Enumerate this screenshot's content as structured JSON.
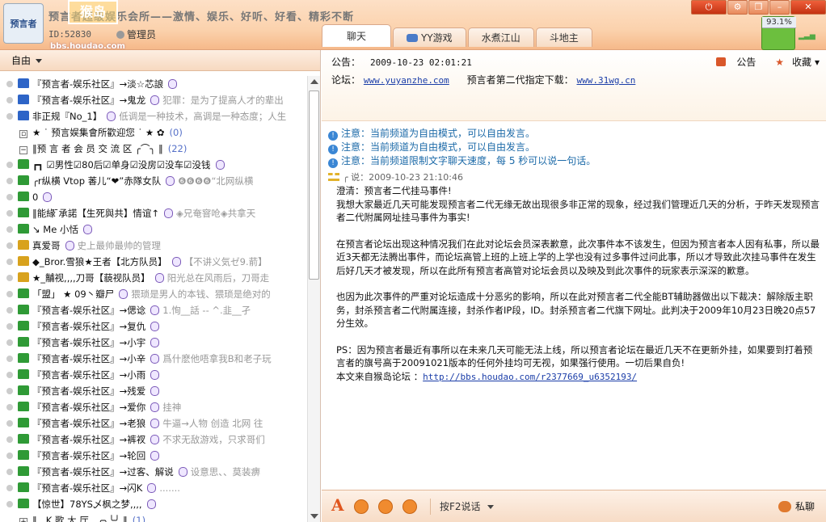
{
  "header": {
    "logo_text": "预言者",
    "room_title": "预言者超级娱乐会所——激情、娱乐、好听、好看、精彩不断",
    "room_id": "ID:52830",
    "manager_label": "管理员",
    "watermark": "猴岛",
    "watermark_url": "bbs.houdao.com"
  },
  "window": {
    "power": "⏻",
    "settings": "⚙",
    "skin": "❐",
    "minimize": "–",
    "close": "✕"
  },
  "status": {
    "battery_pct": "93.1%",
    "signal": "▂▃▅"
  },
  "tabs": [
    {
      "label": "聊天"
    },
    {
      "label": "YY游戏"
    },
    {
      "label": "水煮江山"
    },
    {
      "label": "斗地主"
    }
  ],
  "left_panel": {
    "mode_label": "自由",
    "rows": [
      {
        "name": "『预言者-娱乐社区』→淡☆芯誏",
        "sig": "",
        "shirt": "b"
      },
      {
        "name": "『预言者-娱乐社区』→鬼龙",
        "sig": "犯罪：是为了提高人才的辈出",
        "shirt": "b"
      },
      {
        "name": "非正规『No_1】",
        "sig": "低调是一种技术，高调是一种态度；人生",
        "shirt": "b"
      },
      {
        "group": true,
        "box": "▫",
        "name": "★ ˙ 预言娱集會所歡迎您 ˙ ★ ✿",
        "count": "(0)"
      },
      {
        "group": true,
        "box": "−",
        "name": "‖预 言 者 会 员  交 流 区 ╭⌒╮ ‖",
        "count": "(22)"
      },
      {
        "name": "┏┓ ☑男性☑80后☑单身☑没房☑没车☑没钱",
        "sig": "",
        "shirt": "g"
      },
      {
        "name": "╭r纵横 Vtop 萫儿“❤”赤隊女队",
        "sig": "❻❻❻❻“北网纵横",
        "shirt": "g"
      },
      {
        "name": "0",
        "sig": "",
        "shirt": "g"
      },
      {
        "name": "‖能緣 ̄承諾【生死與共】情谊↑",
        "sig": "◈兄奄窨呛◈共拿天",
        "shirt": "g"
      },
      {
        "name": "↘ Mе 小恬",
        "sig": "",
        "shirt": "g"
      },
      {
        "name": "真爱哥",
        "sig": "史上最帅最帅的管理",
        "shirt": "y"
      },
      {
        "name": "◆_Bror.雪狼★王者【北方队员】",
        "sig": "【不讲义気ゼ9.葥】",
        "shirt": "y"
      },
      {
        "name": "★_黼视,,,,刀哥【藐视队员】",
        "sig": "阳光总在风雨后，刀哥走",
        "shirt": "y"
      },
      {
        "name": "「盟」 ★ 09丶瓣尸",
        "sig": "猥琐是男人的本钱、猥琐是绝对的",
        "shirt": "g"
      },
      {
        "name": "『预言者-娱乐社区』→偲谂",
        "sig": "1.恂__話 -- ^.韭__孑",
        "shirt": "g"
      },
      {
        "name": "『预言者-娱乐社区』→复仇",
        "sig": "",
        "shirt": "g"
      },
      {
        "name": "『预言者-娱乐社区』→小宇",
        "sig": "",
        "shirt": "g"
      },
      {
        "name": "『预言者-娱乐社区』→小辛",
        "sig": "爲什麽他唔拿我B和老子玩",
        "shirt": "g"
      },
      {
        "name": "『预言者-娱乐社区』→小雨",
        "sig": "",
        "shirt": "g"
      },
      {
        "name": "『预言者-娱乐社区』→残爱",
        "sig": "",
        "shirt": "g"
      },
      {
        "name": "『预言者-娱乐社区』→爱你",
        "sig": "挂神",
        "shirt": "g"
      },
      {
        "name": "『预言者-娱乐社区』→老狼",
        "sig": "牛逼→人物  创造 北网 往",
        "shirt": "g"
      },
      {
        "name": "『预言者-娱乐社区』→裤衩",
        "sig": "不求无敌游戏，只求哥们",
        "shirt": "g"
      },
      {
        "name": "『预言者-娱乐社区』→轮回",
        "sig": "",
        "shirt": "g"
      },
      {
        "name": "『预言者-娱乐社区』→过客、解说",
        "sig": "设意思、、莫装痹",
        "shirt": "g"
      },
      {
        "name": "『预言者-娱乐社区』→闪K",
        "sig": ".......",
        "shirt": "g"
      },
      {
        "name": "【惊世】78YS乄枫之梦,,,,",
        "sig": "",
        "shirt": "g"
      },
      {
        "group": true,
        "box": "+",
        "name": "‖ . K 歌 大 厅 . ╭╮╰╯ ‖",
        "count": "(1)"
      }
    ]
  },
  "bulletin": {
    "label": "公告：",
    "time": "2009-10-23 02:01:21",
    "forum_label": "论坛：",
    "forum_url": "www.yuyanzhe.com",
    "download_label": "预言者第二代指定下载：",
    "download_url": "www.31wg.cn",
    "notice_btn": "公告",
    "fav_btn": "收藏"
  },
  "chat": {
    "notices": [
      "注意：当前频道为自由模式，可以自由发言。",
      "注意：当前频道为自由模式，可以自由发言。",
      "注意：当前频道限制文字聊天速度，每 5 秒可以说一句话。"
    ],
    "msg_head": "╭ 说：2009-10-23 21:10:46",
    "paragraphs": [
      "澄清：预言者二代挂马事件!\n我想大家最近几天可能发现预言者二代无缘无故出现很多非正常的现象，经过我们管理近几天的分析，于昨天发现预言者二代附属网址挂马事件为事实!",
      "在预言者论坛出现这种情况我们在此对论坛会员深表歉意，此次事件本不该发生，但因为预言者本人因有私事，所以最近3天都无法腾出事件，而论坛高管上班的上班上学的上学也没有过多事件过问此事，所以才导致此次挂马事件在发生后好几天才被发现，所以在此所有预言者高管对论坛会员以及映及到此次事件的玩家表示深深的歉意。",
      "也因为此次事件的严重对论坛造成十分恶劣的影响，所以在此对预言者二代全能BT辅助器做出以下裁决：解除版主职务，封杀预言者二代附属连接，封杀作者IP段，ID。封杀预言者二代旗下网址。此判决于2009年10月23日晚20点57分生效。",
      "PS：因为预言者最近有事所以在未来几天可能无法上线，所以预言者论坛在最近几天不在更新外挂，如果要到打着预言者的旗号高于20091021版本的任何外挂均可无视，如果强行使用。一切后果自负!"
    ],
    "source_label": "本文来自猴岛论坛 ：",
    "source_url": "http://bbs.houdao.com/r2377669_u6352193/"
  },
  "toolbar": {
    "font_btn": "A",
    "speak_mode": "按F2说话",
    "private_chat": "私聊"
  },
  "colors": {
    "accent": "#e0561e",
    "notice": "#1c6aa8",
    "link": "#1a3da8"
  }
}
